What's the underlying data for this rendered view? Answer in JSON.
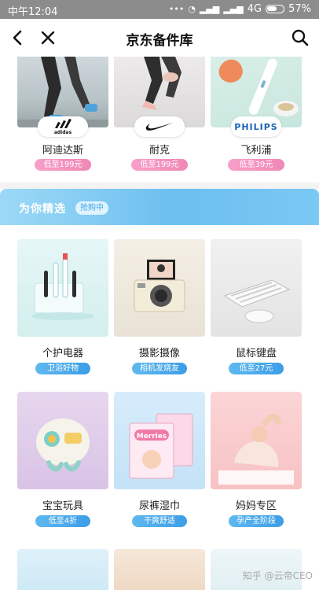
{
  "status_bar": {
    "time": "中午12:04",
    "icons": [
      "more-dots-icon",
      "alarm-icon",
      "signal-icon",
      "signal-icon",
      "4g-icon",
      "battery-icon"
    ],
    "network": "4G",
    "battery": "57%"
  },
  "nav": {
    "title": "京东备件库",
    "back_icon": "back-arrow-icon",
    "close_icon": "close-icon",
    "search_icon": "search-icon"
  },
  "brands": [
    {
      "name": "阿迪达斯",
      "logo": "adidas",
      "badge": "低至199元"
    },
    {
      "name": "耐克",
      "logo": "nike-swoosh",
      "badge": "低至199元"
    },
    {
      "name": "飞利浦",
      "logo": "PHILIPS",
      "badge": "低至39元"
    }
  ],
  "picks": {
    "title": "为你精选",
    "tag": "抢购中",
    "items": [
      {
        "title": "个护电器",
        "pill": "卫浴好物"
      },
      {
        "title": "摄影摄像",
        "pill": "相机发烧友"
      },
      {
        "title": "鼠标键盘",
        "pill": "低至27元"
      },
      {
        "title": "宝宝玩具",
        "pill": "低至4折"
      },
      {
        "title": "尿裤湿巾",
        "pill": "干爽舒适"
      },
      {
        "title": "妈妈专区",
        "pill": "孕产全阶段"
      }
    ],
    "diaper_brand": "Merries"
  },
  "watermark": "知乎 @云帝CEO",
  "colors": {
    "status_bar": "#8c8c8c",
    "brand_badge": "#f088b6",
    "picks_banner": "#6cbff0",
    "pick_pill": "#3c9ee6"
  }
}
